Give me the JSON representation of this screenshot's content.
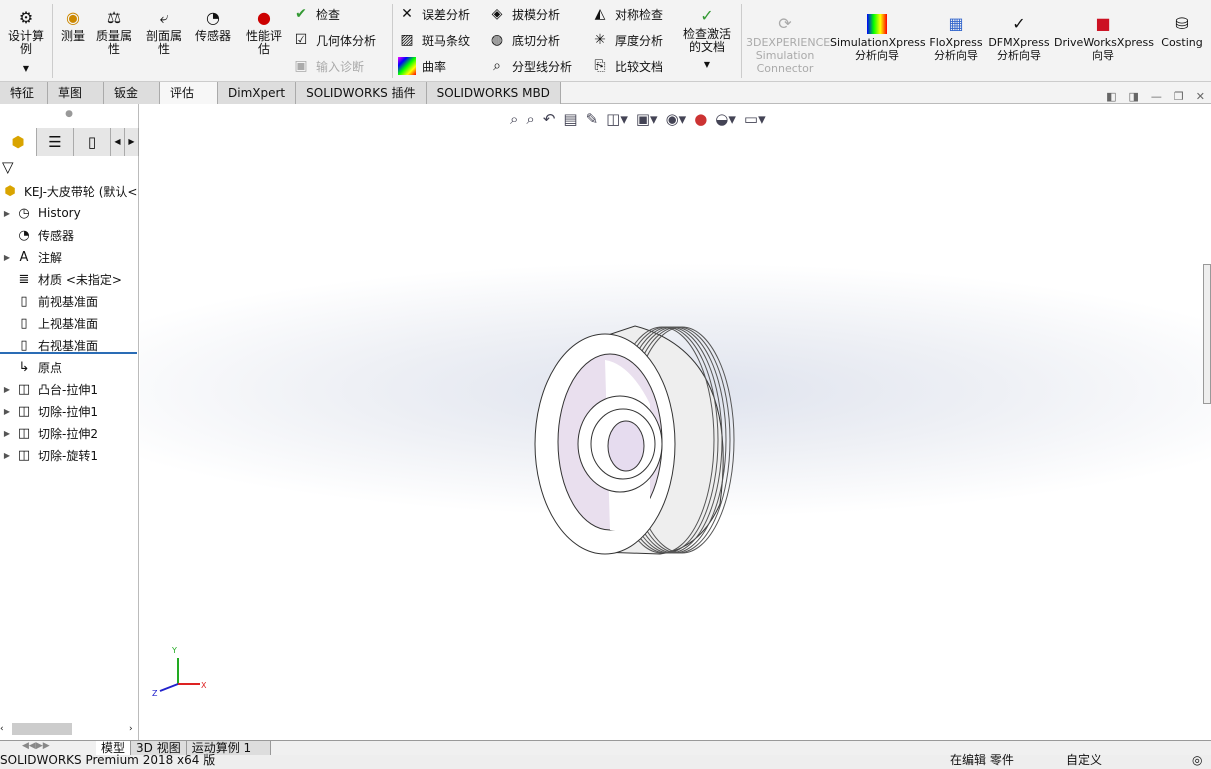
{
  "ribbon": {
    "design_study": "设计算例",
    "measure": "测量",
    "mass_properties": "质量属性",
    "section_properties": "剖面属性",
    "sensor": "传感器",
    "performance": "性能评估",
    "check": "检查",
    "geometry_analysis": "几何体分析",
    "import_diagnostics": "输入诊断",
    "deviation": "误差分析",
    "zebra": "斑马条纹",
    "curvature": "曲率",
    "draft": "拔模分析",
    "undercut": "底切分析",
    "parting_line": "分型线分析",
    "symmetry": "对称检查",
    "thickness": "厚度分析",
    "compare": "比较文档",
    "check_active": "检查激活的文档",
    "experience": "3DEXPERIENCE Simulation Connector",
    "simxpress": "SimulationXpress 分析向导",
    "floxpress": "FloXpress 分析向导",
    "dfmxpress": "DFMXpress 分析向导",
    "driveworks": "DriveWorksXpress 向导",
    "costing": "Costing"
  },
  "tabs": [
    "特征",
    "草图",
    "钣金",
    "评估",
    "DimXpert",
    "SOLIDWORKS 插件",
    "SOLIDWORKS MBD"
  ],
  "active_tab": "评估",
  "tree": {
    "root": "KEJ-大皮带轮 (默认<",
    "items": [
      {
        "label": "History",
        "arrow": true
      },
      {
        "label": "传感器",
        "arrow": false
      },
      {
        "label": "注解",
        "arrow": true
      },
      {
        "label": "材质 <未指定>",
        "arrow": false
      },
      {
        "label": "前视基准面",
        "arrow": false
      },
      {
        "label": "上视基准面",
        "arrow": false
      },
      {
        "label": "右视基准面",
        "arrow": false
      },
      {
        "label": "原点",
        "arrow": false
      },
      {
        "label": "凸台-拉伸1",
        "arrow": true
      },
      {
        "label": "切除-拉伸1",
        "arrow": true
      },
      {
        "label": "切除-拉伸2",
        "arrow": true
      },
      {
        "label": "切除-旋转1",
        "arrow": true
      }
    ]
  },
  "triad": {
    "x": "X",
    "y": "Y",
    "z": "Z"
  },
  "bottom_tabs": [
    "模型",
    "3D 视图",
    "运动算例 1"
  ],
  "status": {
    "app": "SOLIDWORKS Premium 2018 x64 版",
    "editing": "在编辑 零件",
    "custom": "自定义"
  }
}
